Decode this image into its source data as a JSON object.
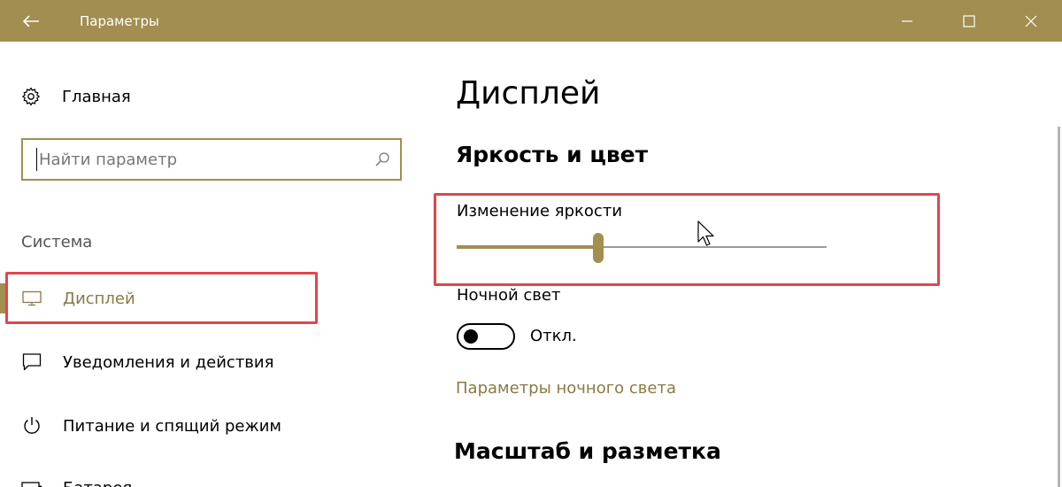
{
  "window": {
    "title": "Параметры"
  },
  "colors": {
    "accent": "#a28e50",
    "accent_text": "#8a7a44",
    "highlight": "#e0464e"
  },
  "sidebar": {
    "home_label": "Главная",
    "search_placeholder": "Найти параметр",
    "group_label": "Система",
    "items": [
      {
        "label": "Дисплей",
        "icon": "monitor-icon",
        "selected": true
      },
      {
        "label": "Уведомления и действия",
        "icon": "notification-icon",
        "selected": false
      },
      {
        "label": "Питание и спящий режим",
        "icon": "power-icon",
        "selected": false
      },
      {
        "label": "Батарея",
        "icon": "battery-icon",
        "selected": false
      }
    ]
  },
  "main": {
    "title": "Дисплей",
    "section_brightness": "Яркость и цвет",
    "brightness_label": "Изменение яркости",
    "brightness_value": 38,
    "night_light_label": "Ночной свет",
    "night_light_state": "Откл.",
    "night_light_on": false,
    "night_light_link": "Параметры ночного света",
    "section_scale": "Масштаб и разметка"
  }
}
